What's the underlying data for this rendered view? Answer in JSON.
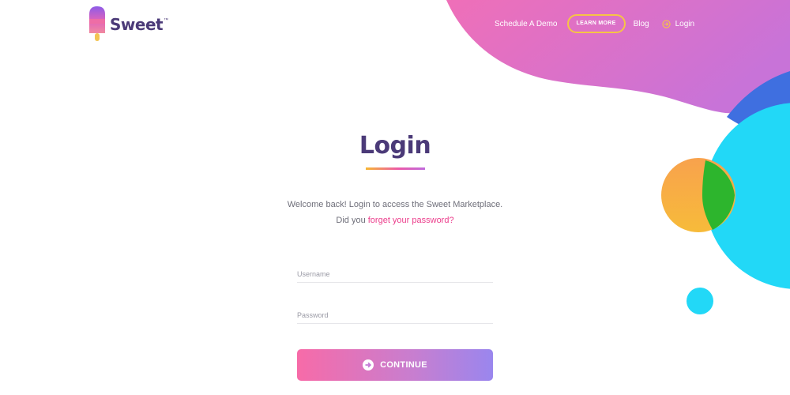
{
  "brand": {
    "name": "Sweet",
    "trademark": "™"
  },
  "nav": {
    "schedule_demo": "Schedule A Demo",
    "learn_more": "LEARN MORE",
    "blog": "Blog",
    "login": "Login"
  },
  "main": {
    "title": "Login",
    "welcome": "Welcome back! Login to access the Sweet Marketplace.",
    "forget_prefix": "Did you",
    "forget_link": "forget your password?",
    "username_placeholder": "Username",
    "password_placeholder": "Password",
    "continue_label": "CONTINUE"
  },
  "icons": {
    "logo": "popsicle-icon",
    "login": "arrow-circle-right-icon",
    "continue": "arrow-circle-right-icon"
  },
  "colors": {
    "brand_purple": "#4b3a78",
    "accent_pink": "#ec3e8c",
    "learn_more_border": "#f6c445",
    "blob_pink": "#e56fc4",
    "blob_cyan": "#22d6f6",
    "blob_blue": "#3d72e0",
    "circle_orange": "#f7a94a",
    "circle_green": "#2db52d"
  }
}
